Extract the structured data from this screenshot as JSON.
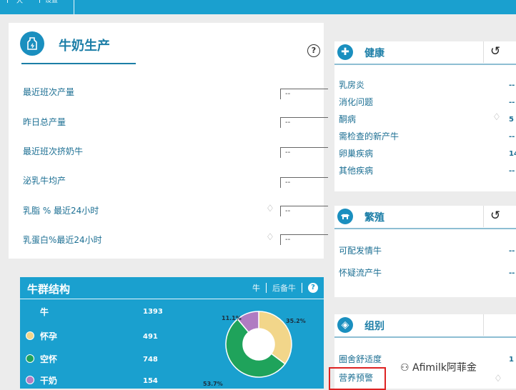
{
  "topbar": {
    "tab1": "人",
    "tab2": "设置"
  },
  "milk": {
    "title": "牛奶生产",
    "metrics": [
      {
        "label": "最近班次产量",
        "value": "--"
      },
      {
        "label": "昨日总产量",
        "value": "--"
      },
      {
        "label": "最近班次挤奶牛",
        "value": "--"
      },
      {
        "label": "泌乳牛均产",
        "value": "--"
      },
      {
        "label": "乳脂 % 最近24小时",
        "value": "--"
      },
      {
        "label": "乳蛋白%最近24小时",
        "value": "--"
      }
    ]
  },
  "herd": {
    "title": "牛群结构",
    "tabs": [
      "牛",
      "后备牛"
    ],
    "help": "?",
    "total_label": "牛",
    "total_value": "1393",
    "rows": [
      {
        "label": "怀孕",
        "value": "491",
        "color": "#f2d68a"
      },
      {
        "label": "空怀",
        "value": "748",
        "color": "#1fa35b"
      },
      {
        "label": "干奶",
        "value": "154",
        "color": "#b07cc2"
      }
    ]
  },
  "chart_data": {
    "type": "pie",
    "categories": [
      "怀孕",
      "空怀",
      "干奶"
    ],
    "values": [
      35.2,
      53.7,
      11.1
    ],
    "labels": [
      "35.2%",
      "53.7%",
      "11.1%"
    ],
    "colors": [
      "#f2d68a",
      "#1fa35b",
      "#b07cc2"
    ]
  },
  "health": {
    "title": "健康",
    "items": [
      {
        "label": "乳房炎",
        "value": "--"
      },
      {
        "label": "消化问题",
        "value": "--"
      },
      {
        "label": "酮病",
        "value": "5"
      },
      {
        "label": "需检查的新产牛",
        "value": "--"
      },
      {
        "label": "卵巢疾病",
        "value": "14"
      },
      {
        "label": "其他疾病",
        "value": "--"
      }
    ]
  },
  "breeding": {
    "title": "繁殖",
    "items": [
      {
        "label": "可配发情牛",
        "value": "--"
      },
      {
        "label": "怀疑流产牛",
        "value": "--"
      }
    ]
  },
  "group": {
    "title": "组别",
    "items": [
      {
        "label": "圈舍舒适度",
        "value": "1"
      },
      {
        "label": "营养预警",
        "value": ""
      }
    ]
  },
  "watermark": "Afimilk阿菲金"
}
